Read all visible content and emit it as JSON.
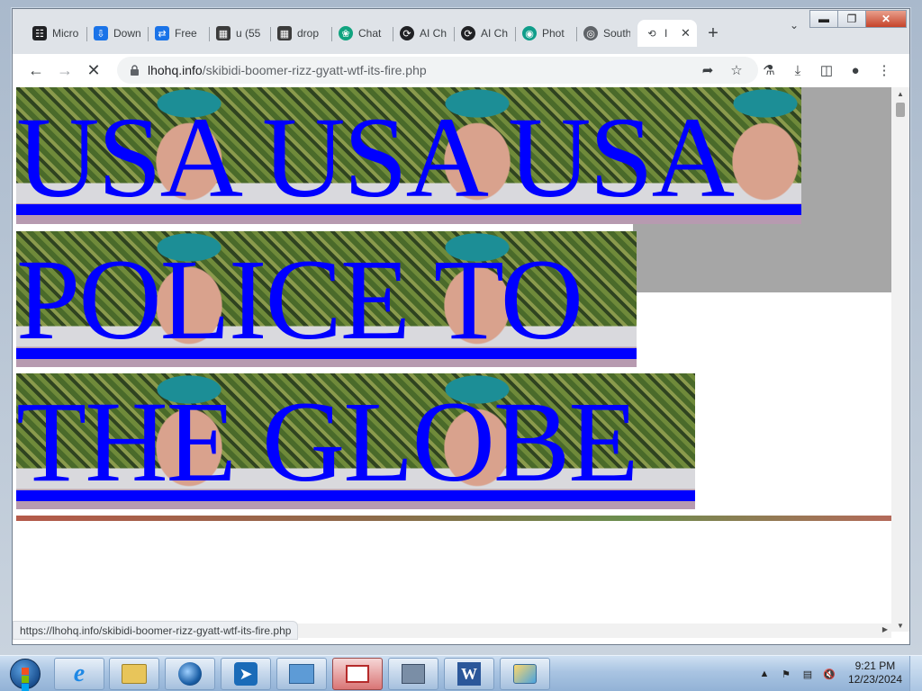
{
  "browser": {
    "tabs": [
      {
        "label": "Micro",
        "icon": "building-columns-icon",
        "color": "#202124"
      },
      {
        "label": "Down",
        "icon": "download-icon",
        "color": "#1a73e8"
      },
      {
        "label": "Free",
        "icon": "convert-icon",
        "color": "#1a73e8"
      },
      {
        "label": "u (55",
        "icon": "thumbnail-icon",
        "color": "#3b3b3b"
      },
      {
        "label": "drop",
        "icon": "thumbnail-icon",
        "color": "#3b3b3b"
      },
      {
        "label": "Chat",
        "icon": "openai-icon",
        "color": "#10a37f"
      },
      {
        "label": "AI Ch",
        "icon": "ai-swirl-icon",
        "color": "#202124"
      },
      {
        "label": "AI Ch",
        "icon": "ai-swirl-icon",
        "color": "#202124"
      },
      {
        "label": "Phot",
        "icon": "photo-app-icon",
        "color": "#0f9d8a"
      },
      {
        "label": "South",
        "icon": "globe-icon",
        "color": "#5f6368"
      },
      {
        "label": "I",
        "icon": "loading-icon",
        "color": "#5f6368",
        "active": true
      }
    ],
    "url_domain": "lhohq.info",
    "url_path": "/skibidi-boomer-rizz-gyatt-wtf-its-fire.php",
    "status_url": "https://lhohq.info/skibidi-boomer-rizz-gyatt-wtf-its-fire.php"
  },
  "page": {
    "line1": "USA USA USA",
    "line2": "POLICE TO",
    "line3": "THE GLOBE",
    "text_color": "#0000ff"
  },
  "taskbar": {
    "time": "9:21 PM",
    "date": "12/23/2024",
    "apps": [
      "internet-explorer-icon",
      "file-explorer-icon",
      "media-player-icon",
      "remote-app-icon",
      "control-panel-icon",
      "active-window-icon",
      "network-computer-icon",
      "word-icon",
      "paint-icon"
    ]
  }
}
